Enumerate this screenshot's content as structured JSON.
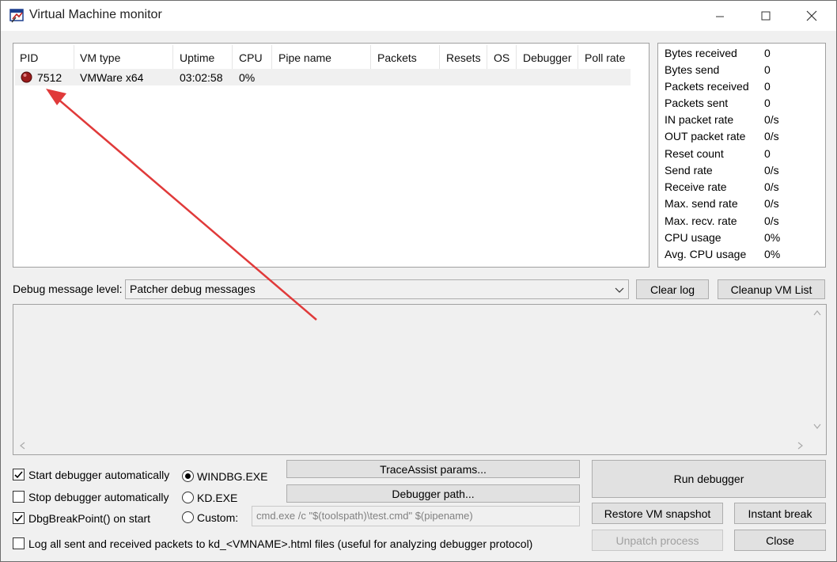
{
  "window": {
    "title": "Virtual Machine monitor"
  },
  "vm_table": {
    "columns": [
      "PID",
      "VM type",
      "Uptime",
      "CPU",
      "Pipe name",
      "Packets",
      "Resets",
      "OS",
      "Debugger",
      "Poll rate"
    ],
    "rows": [
      {
        "pid": "7512",
        "vm_type": "VMWare x64",
        "uptime": "03:02:58",
        "cpu": "0%",
        "pipe_name": "",
        "packets": "",
        "resets": "",
        "os": "",
        "debugger": "",
        "poll_rate": ""
      }
    ]
  },
  "stats": [
    {
      "label": "Bytes received",
      "value": "0"
    },
    {
      "label": "Bytes send",
      "value": "0"
    },
    {
      "label": "Packets received",
      "value": "0"
    },
    {
      "label": "Packets sent",
      "value": "0"
    },
    {
      "label": "IN packet rate",
      "value": "0/s"
    },
    {
      "label": "OUT packet rate",
      "value": "0/s"
    },
    {
      "label": "Reset count",
      "value": "0"
    },
    {
      "label": "Send rate",
      "value": "0/s"
    },
    {
      "label": "Receive rate",
      "value": "0/s"
    },
    {
      "label": "Max. send rate",
      "value": "0/s"
    },
    {
      "label": "Max. recv. rate",
      "value": "0/s"
    },
    {
      "label": "CPU usage",
      "value": "0%"
    },
    {
      "label": "Avg. CPU usage",
      "value": "0%"
    }
  ],
  "debug": {
    "level_label": "Debug message level:",
    "level_value": "Patcher debug messages",
    "clear_log": "Clear log",
    "cleanup_vm_list": "Cleanup VM List"
  },
  "options": {
    "start_auto": {
      "label": "Start debugger automatically",
      "checked": true
    },
    "stop_auto": {
      "label": "Stop debugger automatically",
      "checked": false
    },
    "dbgbreak": {
      "label": "DbgBreakPoint() on start",
      "checked": true
    },
    "log_packets": {
      "label": "Log all sent and received packets to kd_<VMNAME>.html files (useful for analyzing debugger protocol)",
      "checked": false
    }
  },
  "debugger_choice": {
    "windbg": "WINDBG.EXE",
    "kd": "KD.EXE",
    "custom": "Custom:",
    "selected": "windbg",
    "custom_cmd": "cmd.exe /c \"$(toolspath)\\test.cmd\" $(pipename)"
  },
  "buttons": {
    "traceassist": "TraceAssist params...",
    "debugger_path": "Debugger path...",
    "run_debugger": "Run debugger",
    "restore_snapshot": "Restore VM snapshot",
    "instant_break": "Instant break",
    "unpatch": "Unpatch process",
    "close": "Close"
  },
  "colors": {
    "annotation_arrow": "#e03a3a",
    "vm_status_icon": "#9b1b1b"
  }
}
